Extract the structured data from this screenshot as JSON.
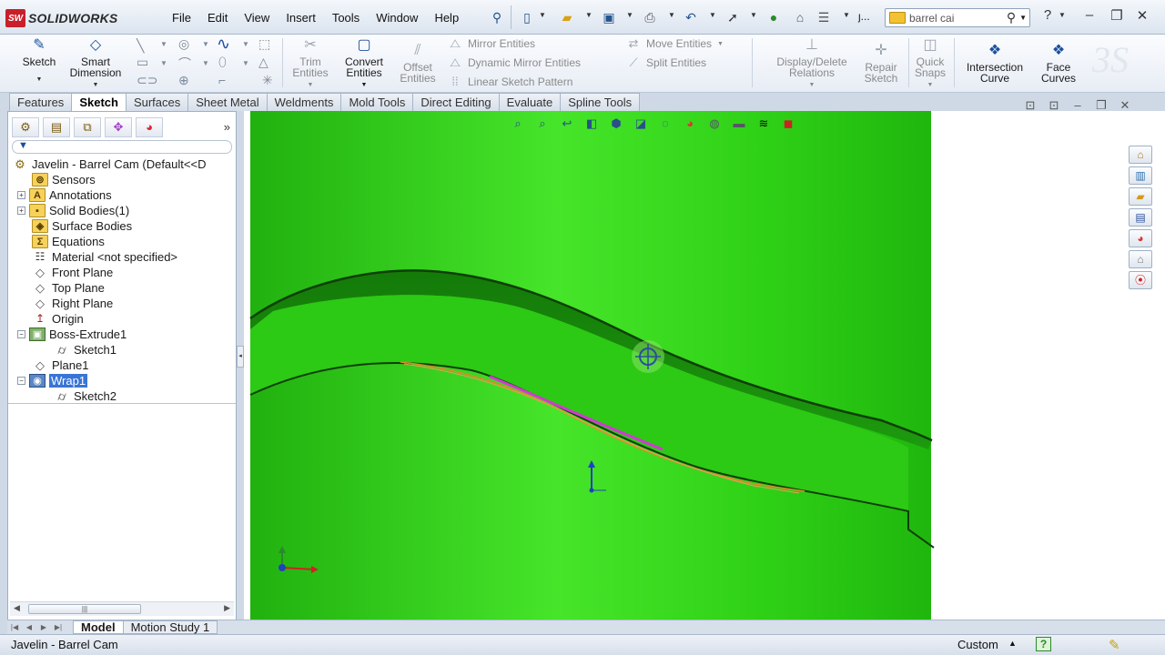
{
  "app": {
    "logo_badge": "SW",
    "logo_text": "SOLIDWORKS"
  },
  "menu": [
    "File",
    "Edit",
    "View",
    "Insert",
    "Tools",
    "Window",
    "Help"
  ],
  "search": {
    "text": "barrel cai"
  },
  "quickaccess_more": "ȷ...",
  "commands": {
    "sketch": "Sketch",
    "smart_dimension": [
      "Smart",
      "Dimension"
    ],
    "trim": [
      "Trim",
      "Entities"
    ],
    "convert": [
      "Convert",
      "Entities"
    ],
    "offset": [
      "Offset",
      "Entities"
    ],
    "mirror": "Mirror Entities",
    "dynamic_mirror": "Dynamic Mirror Entities",
    "linear_pattern": "Linear Sketch Pattern",
    "move": "Move Entities",
    "split": "Split Entities",
    "display_delete": [
      "Display/Delete",
      "Relations"
    ],
    "repair": [
      "Repair",
      "Sketch"
    ],
    "quick_snaps": [
      "Quick",
      "Snaps"
    ],
    "intersection": [
      "Intersection",
      "Curve"
    ],
    "face_curves": [
      "Face",
      "Curves"
    ]
  },
  "tabs": [
    "Features",
    "Sketch",
    "Surfaces",
    "Sheet Metal",
    "Weldments",
    "Mold Tools",
    "Direct Editing",
    "Evaluate",
    "Spline Tools"
  ],
  "active_tab": "Sketch",
  "tree": {
    "root": "Javelin - Barrel Cam  (Default<<D",
    "items": [
      {
        "label": "Sensors",
        "icon": "folder-icon"
      },
      {
        "label": "Annotations",
        "icon": "annotations-icon"
      },
      {
        "label": "Solid Bodies(1)",
        "icon": "folder-icon"
      },
      {
        "label": "Surface Bodies",
        "icon": "folder-icon"
      },
      {
        "label": "Equations",
        "icon": "equations-icon"
      },
      {
        "label": "Material <not specified>",
        "icon": "material-icon"
      },
      {
        "label": "Front Plane",
        "icon": "plane-icon"
      },
      {
        "label": "Top Plane",
        "icon": "plane-icon"
      },
      {
        "label": "Right Plane",
        "icon": "plane-icon"
      },
      {
        "label": "Origin",
        "icon": "origin-icon"
      },
      {
        "label": "Boss-Extrude1",
        "icon": "extrude-icon"
      },
      {
        "label": "Sketch1",
        "icon": "sketch-icon"
      },
      {
        "label": "Plane1",
        "icon": "plane-icon"
      },
      {
        "label": "Wrap1",
        "icon": "wrap-icon"
      },
      {
        "label": "Sketch2",
        "icon": "sketch-icon"
      }
    ]
  },
  "bottom_tabs": [
    "Model",
    "Motion Study 1"
  ],
  "status": {
    "left": "Javelin - Barrel Cam",
    "units": "Custom",
    "units_arrow": "▲",
    "help": "?"
  },
  "colors": {
    "cylinder": "#2ecf16",
    "sketch_curve": "#e08a2a",
    "selected_edge": "#d23ad0",
    "selection_blue": "#3875d6"
  }
}
